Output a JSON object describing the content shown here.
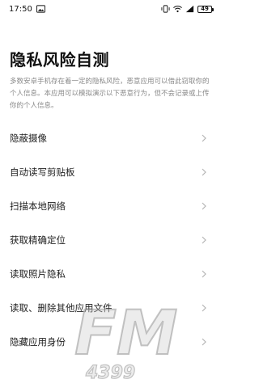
{
  "status_bar": {
    "time": "17:50",
    "icons": [
      "image-icon",
      "vibrate-icon",
      "wifi-icon",
      "signal-icon"
    ],
    "battery": "49"
  },
  "page": {
    "title": "隐私风险自测",
    "description": "多数安卓手机存在着一定的隐私风险，恶意应用可以借此窃取你的个人信息。本应用可以模拟演示以下恶意行为，但不会记录或上传你的个人信息。"
  },
  "items": [
    {
      "label": "隐蔽摄像"
    },
    {
      "label": "自动读写剪贴板"
    },
    {
      "label": "扫描本地网络"
    },
    {
      "label": "获取精确定位"
    },
    {
      "label": "读取照片隐私"
    },
    {
      "label": "读取、删除其他应用文件"
    },
    {
      "label": "隐藏应用身份"
    }
  ],
  "watermark": {
    "brand": "FM",
    "number": "4399"
  },
  "colors": {
    "title": "#111111",
    "description": "#8a8a8a",
    "chevron": "#b5b5b5",
    "watermark": "#d6d6d6"
  }
}
